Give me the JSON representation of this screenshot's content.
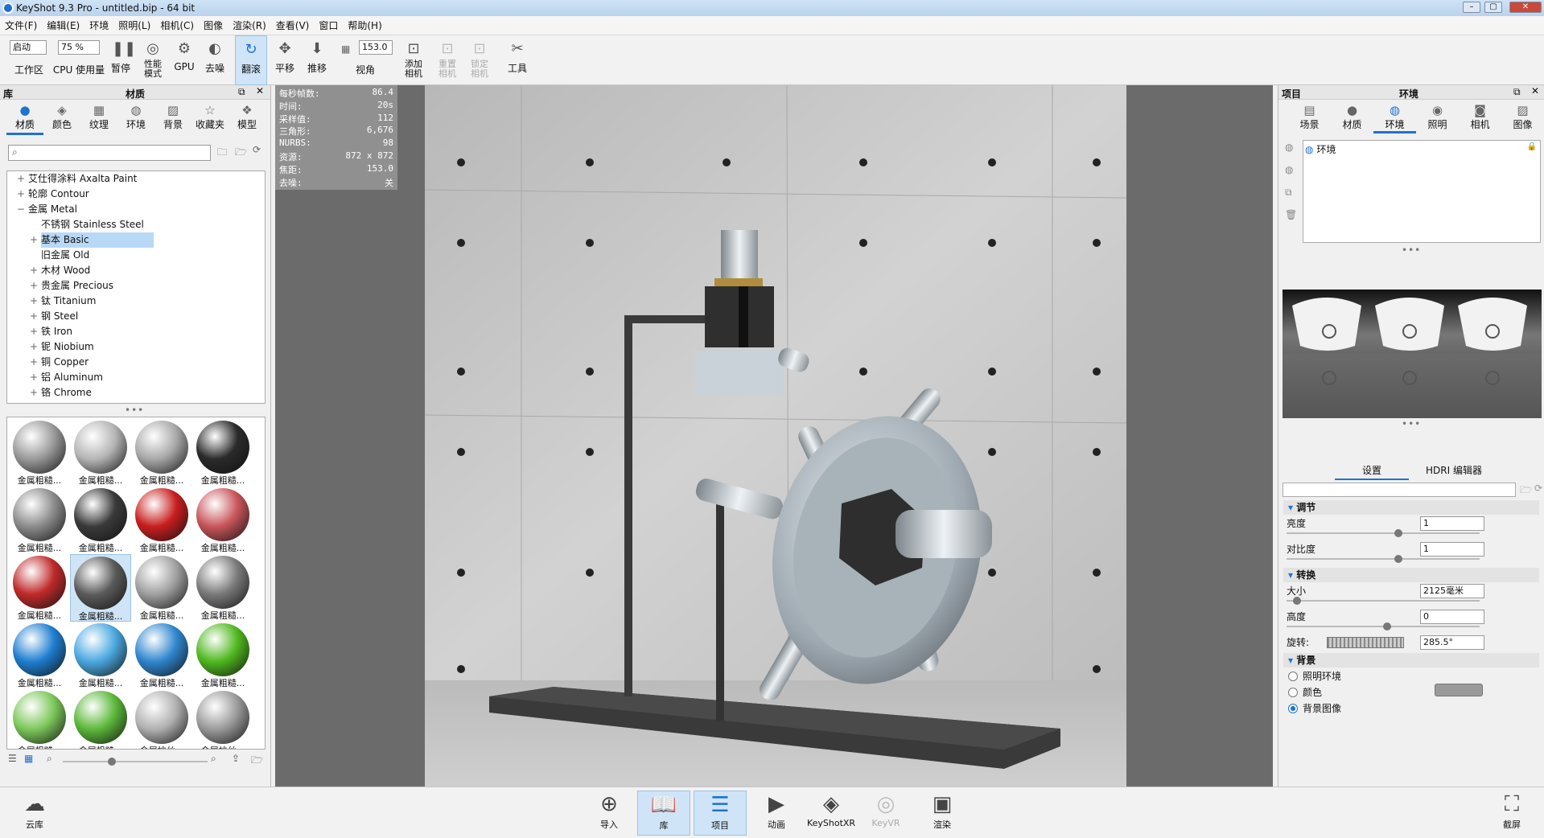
{
  "window": {
    "title": "KeyShot 9.3 Pro  - untitled.bip - 64 bit"
  },
  "menu": [
    "文件(F)",
    "编辑(E)",
    "环境",
    "照明(L)",
    "相机(C)",
    "图像",
    "渲染(R)",
    "查看(V)",
    "窗口",
    "帮助(H)"
  ],
  "toolbar": {
    "mode_value": "启动",
    "cpu_value": "75 %",
    "workspace": "工作区",
    "cpu_usage": "CPU 使用量",
    "pause": "暂停",
    "perf_mode": "性能\n模式",
    "gpu": "GPU",
    "denoise": "去噪",
    "tumble": "翻滚",
    "pan": "平移",
    "dolly": "推移",
    "fov_value": "153.0",
    "fov": "视角",
    "add_camera": "添加\n相机",
    "reset_camera": "重置\n相机",
    "lock_camera": "锁定\n相机",
    "tools": "工具"
  },
  "library": {
    "header_left": "库",
    "header_title": "材质",
    "tabs": [
      "材质",
      "颜色",
      "纹理",
      "环境",
      "背景",
      "收藏夹",
      "模型"
    ],
    "tree": [
      {
        "label": "艾仕得涂料 Axalta Paint",
        "level": 0,
        "exp": "+"
      },
      {
        "label": "轮廓 Contour",
        "level": 0,
        "exp": "+"
      },
      {
        "label": "金属 Metal",
        "level": 0,
        "exp": "−"
      },
      {
        "label": "不锈钢 Stainless Steel",
        "level": 1,
        "exp": ""
      },
      {
        "label": "基本 Basic",
        "level": 1,
        "exp": "+",
        "hl": true
      },
      {
        "label": "旧金属 Old",
        "level": 1,
        "exp": ""
      },
      {
        "label": "木材 Wood",
        "level": 1,
        "exp": "+"
      },
      {
        "label": "贵金属 Precious",
        "level": 1,
        "exp": "+"
      },
      {
        "label": "钛 Titanium",
        "level": 1,
        "exp": "+"
      },
      {
        "label": "钢 Steel",
        "level": 1,
        "exp": "+"
      },
      {
        "label": "铁 Iron",
        "level": 1,
        "exp": "+"
      },
      {
        "label": "铌 Niobium",
        "level": 1,
        "exp": "+"
      },
      {
        "label": "铜 Copper",
        "level": 1,
        "exp": "+"
      },
      {
        "label": "铝 Aluminum",
        "level": 1,
        "exp": "+"
      },
      {
        "label": "铬 Chrome",
        "level": 1,
        "exp": "+"
      }
    ],
    "thumbs": [
      {
        "cap": "金属粗糙...",
        "color": "#9a9a9a"
      },
      {
        "cap": "金属粗糙...",
        "color": "#b5b5b5"
      },
      {
        "cap": "金属粗糙...",
        "color": "#a8a8a8"
      },
      {
        "cap": "金属粗糙...",
        "color": "#2a2a2a"
      },
      {
        "cap": "金属粗糙...",
        "color": "#8c8c8c"
      },
      {
        "cap": "金属粗糙...",
        "color": "#3a3a3a"
      },
      {
        "cap": "金属粗糙...",
        "color": "#c81e1e"
      },
      {
        "cap": "金属粗糙...",
        "color": "#c8555a"
      },
      {
        "cap": "金属粗糙...",
        "color": "#c02a2a"
      },
      {
        "cap": "金属粗糙...",
        "color": "#5a5a5a",
        "on": true
      },
      {
        "cap": "金属粗糙...",
        "color": "#a0a0a0"
      },
      {
        "cap": "金属粗糙...",
        "color": "#7a7a7a"
      },
      {
        "cap": "金属粗糙...",
        "color": "#1e7ed0"
      },
      {
        "cap": "金属粗糙...",
        "color": "#4aa8e0"
      },
      {
        "cap": "金属粗糙...",
        "color": "#2f86cf"
      },
      {
        "cap": "金属粗糙...",
        "color": "#4fb81e"
      },
      {
        "cap": "金属粗糙...",
        "color": "#7cc85a"
      },
      {
        "cap": "金属粗糙...",
        "color": "#5cb83a"
      },
      {
        "cap": "金属拉丝...",
        "color": "#b0b0b0"
      },
      {
        "cap": "金属拉丝...",
        "color": "#9a9a9a"
      }
    ]
  },
  "stats": [
    {
      "k": "每秒帧数:",
      "v": "86.4"
    },
    {
      "k": "时间:",
      "v": "20s"
    },
    {
      "k": "采样值:",
      "v": "112"
    },
    {
      "k": "三角形:",
      "v": "6,676"
    },
    {
      "k": "NURBS:",
      "v": "98"
    },
    {
      "k": "资源:",
      "v": "872 x 872"
    },
    {
      "k": "焦距:",
      "v": "153.0"
    },
    {
      "k": "去噪:",
      "v": "关"
    }
  ],
  "project": {
    "header_left": "项目",
    "header_title": "环境",
    "tabs": [
      "场景",
      "材质",
      "环境",
      "照明",
      "相机",
      "图像"
    ],
    "env_item": "环境",
    "subtabs": [
      "设置",
      "HDRI 编辑器"
    ],
    "sections": {
      "adjust": "调节",
      "transform": "转换",
      "background": "背景"
    },
    "brightness_label": "亮度",
    "brightness_value": "1",
    "contrast_label": "对比度",
    "contrast_value": "1",
    "size_label": "大小",
    "size_value": "2125毫米",
    "height_label": "高度",
    "height_value": "0",
    "rotation_label": "旋转:",
    "rotation_value": "285.5°",
    "bg_options": [
      "照明环境",
      "颜色",
      "背景图像"
    ],
    "bg_selected": "背景图像"
  },
  "bottom": [
    {
      "label": "云库",
      "icon": "☁"
    },
    {
      "label": "导入",
      "icon": "⊕"
    },
    {
      "label": "库",
      "icon": "📖"
    },
    {
      "label": "项目",
      "icon": "☰"
    },
    {
      "label": "动画",
      "icon": "▶"
    },
    {
      "label": "KeyShotXR",
      "icon": "◈"
    },
    {
      "label": "KeyVR",
      "icon": "◎"
    },
    {
      "label": "渲染",
      "icon": "▣"
    },
    {
      "label": "截屏",
      "icon": "⛶"
    }
  ],
  "colors": {
    "accent": "#1e73d0",
    "highlight": "#cfe4f7"
  }
}
